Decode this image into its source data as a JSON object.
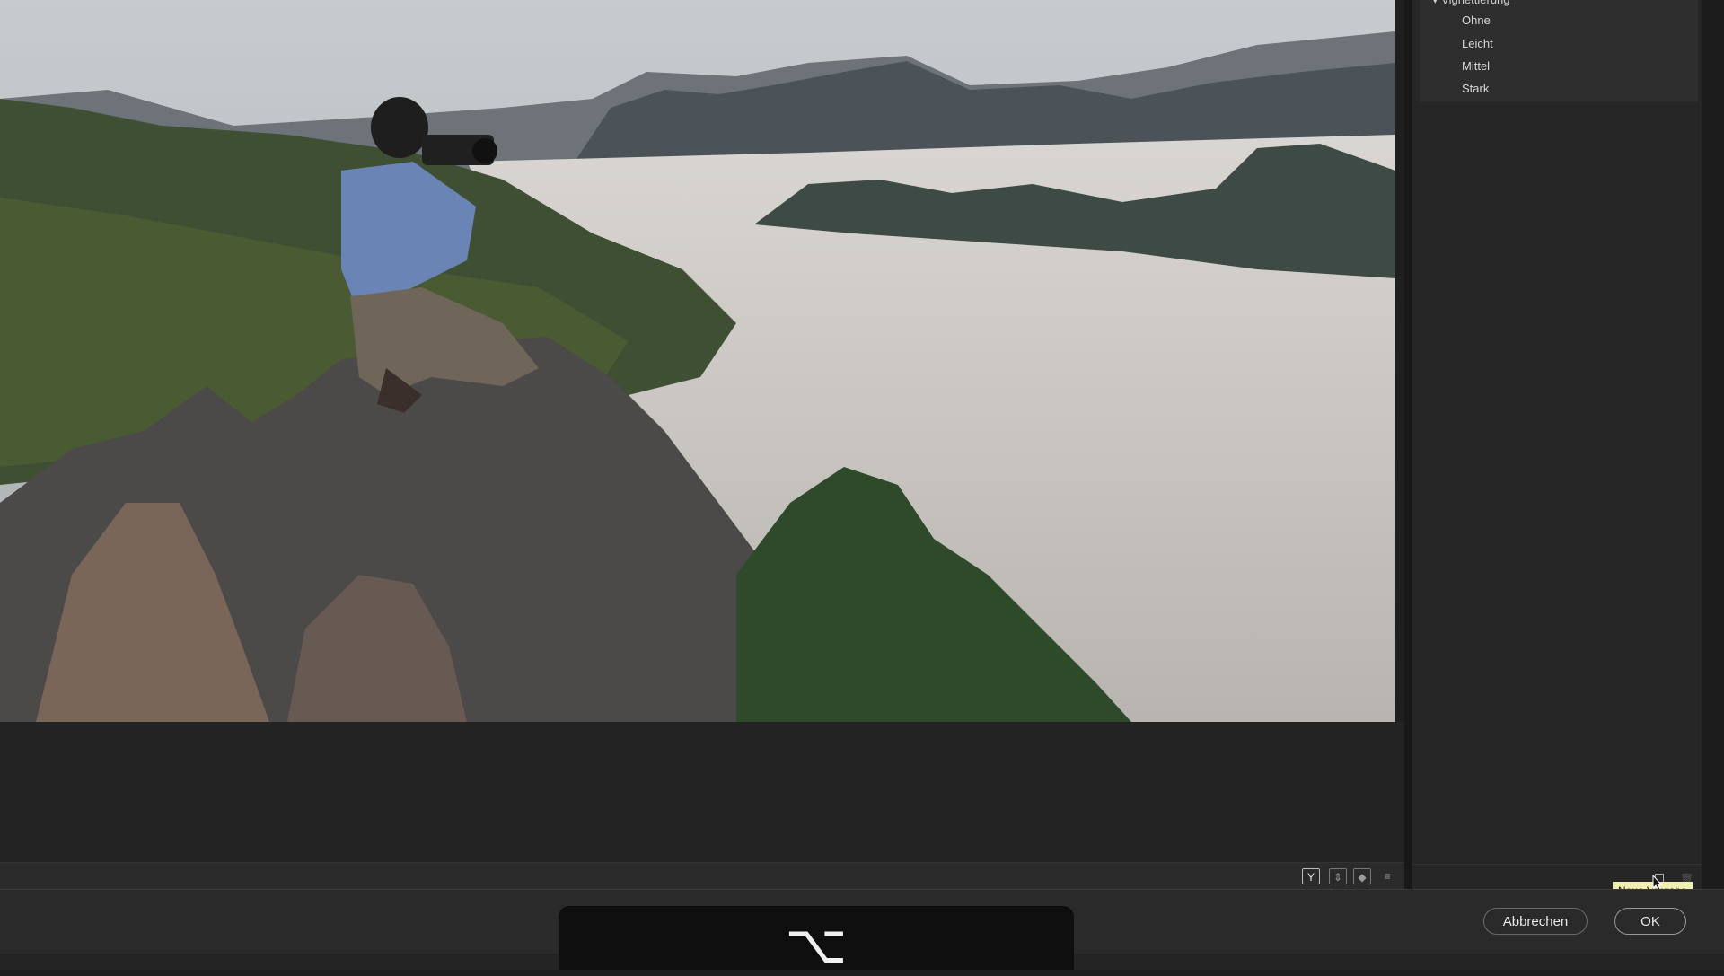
{
  "preset_panel": {
    "group_label": "▾ Vignettierung",
    "items": [
      {
        "label": "Ohne"
      },
      {
        "label": "Leicht"
      },
      {
        "label": "Mittel"
      },
      {
        "label": "Stark"
      }
    ]
  },
  "view_bar": {
    "icons": [
      "before-after-split-icon",
      "compare-vertical-icon",
      "compare-horizontal-icon",
      "settings-icon"
    ]
  },
  "tooltip": {
    "text": "Neue Vorgabe"
  },
  "footer": {
    "cancel_label": "Abbrechen",
    "ok_label": "OK"
  },
  "key_overlay": {
    "glyph": "⌥"
  },
  "colors": {
    "panel_bg": "#262626",
    "group_bg": "#2e2e2e",
    "footer_bg": "#2a2a2a",
    "tooltip_bg": "#f2eeb0"
  }
}
